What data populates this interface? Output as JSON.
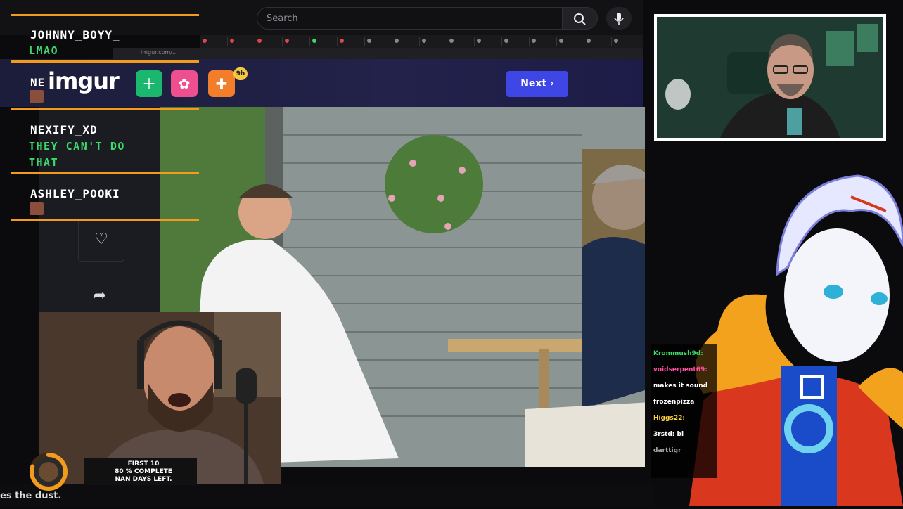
{
  "browser": {
    "search_placeholder": "Search",
    "address": "imgur.com/..."
  },
  "imgur": {
    "logo": "imgur",
    "notification_badge": "9h",
    "next_label": "Next",
    "next_arrow": "›"
  },
  "stream_chat": [
    {
      "user": "JOHNNY_BOYY_",
      "message": "LMAO"
    },
    {
      "user": "NE",
      "message": ""
    },
    {
      "user": "NEXIFY_XD",
      "message": "THEY CAN'T DO",
      "message2": "THAT"
    },
    {
      "user": "ASHLEY_POOKI",
      "message": ""
    }
  ],
  "mini_chat": [
    {
      "text": "Krommush9d:",
      "color": "#3bd96a"
    },
    {
      "text": "voidserpent69:",
      "color": "#ff4fa0"
    },
    {
      "text": "makes it sound",
      "color": "#ffffff"
    },
    {
      "text": "frozenpizza",
      "color": "#ffffff"
    },
    {
      "text": "Higgs22:",
      "color": "#ffd23b"
    },
    {
      "text": "3rstd: bi",
      "color": "#ffffff"
    },
    {
      "text": "darttigr",
      "color": "#aaaaaa"
    }
  ],
  "sub_goal": {
    "line1": "FIRST 10",
    "line2": "80 % COMPLETE",
    "line3": "NAN DAYS LEFT.",
    "progress": 0.8
  },
  "bottom_caption": "es the dust.",
  "colors": {
    "accent_orange": "#f29b1c",
    "chat_green": "#3bd96a",
    "imgur_next": "#3e47e6"
  }
}
